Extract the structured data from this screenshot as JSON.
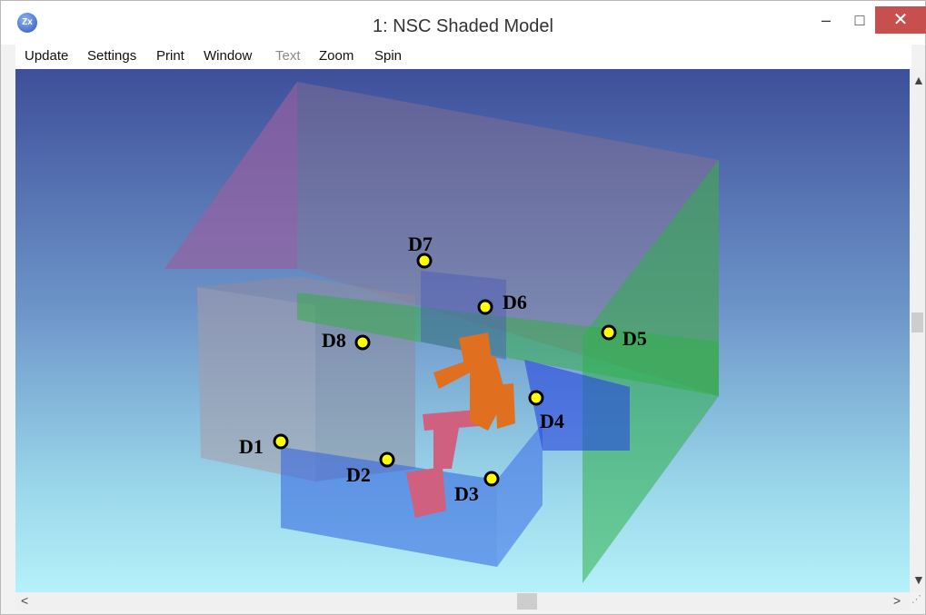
{
  "window": {
    "title": "1: NSC Shaded Model",
    "app_icon": "zemax-logo-icon",
    "icon_text": "Zx"
  },
  "controls": {
    "minimize": "–",
    "maximize": "□",
    "close": "✕"
  },
  "menu": {
    "items": [
      "Update",
      "Settings",
      "Print",
      "Window",
      "Text",
      "Zoom",
      "Spin"
    ],
    "disabled": [
      "Text"
    ]
  },
  "detectors": [
    "D1",
    "D2",
    "D3",
    "D4",
    "D5",
    "D6",
    "D7",
    "D8"
  ],
  "scroll_arrows": {
    "up": "▲",
    "down": "▼",
    "left": "<",
    "right": ">"
  },
  "colors": {
    "background_top": "#3e4f9a",
    "background_bottom": "#b5f1f8",
    "marker": "#ffff00",
    "robot_orange": "#e07020",
    "robot_pink": "#d06080"
  }
}
